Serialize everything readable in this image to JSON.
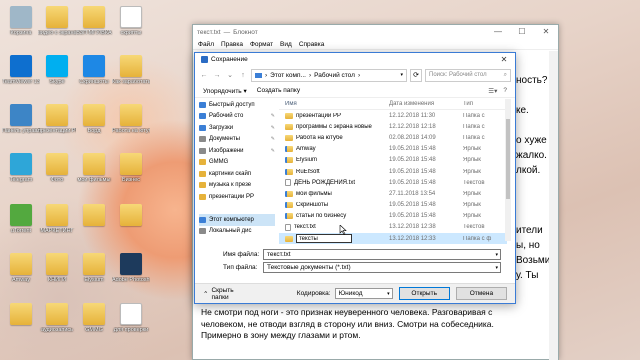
{
  "desktop": {
    "icons": [
      {
        "label": "Корзина",
        "kind": "trash",
        "color": "#9fb7c8"
      },
      {
        "label": "видео с экрана",
        "kind": "folder",
        "color": "#e6b23a"
      },
      {
        "label": "ВЗП МГУ/ВКА",
        "kind": "folder",
        "color": "#e6b23a"
      },
      {
        "label": "скрипты",
        "kind": "doc",
        "color": "#ffffff"
      },
      {
        "label": "TeamViewer 13",
        "kind": "app",
        "color": "#0e6fcf"
      },
      {
        "label": "Skype",
        "kind": "app",
        "color": "#00aff0"
      },
      {
        "label": "Скриншоты",
        "kind": "app",
        "color": "#1e88e5"
      },
      {
        "label": "Как заработать",
        "kind": "folder",
        "color": "#e6b23a"
      },
      {
        "label": "Панель управления",
        "kind": "app",
        "color": "#3d85c6"
      },
      {
        "label": "презентации PP",
        "kind": "folder",
        "color": "#e6b23a"
      },
      {
        "label": "Ворд",
        "kind": "folder",
        "color": "#e6b23a"
      },
      {
        "label": "Работа на ютубе",
        "kind": "folder",
        "color": "#e6b23a"
      },
      {
        "label": "Telegram",
        "kind": "app",
        "color": "#2ea6d8"
      },
      {
        "label": "Фото",
        "kind": "folder",
        "color": "#e6b23a"
      },
      {
        "label": "мои фильмы",
        "kind": "folder",
        "color": "#7a7a7a"
      },
      {
        "label": "Бизнес",
        "kind": "folder",
        "color": "#e6b23a"
      },
      {
        "label": "uTorrent",
        "kind": "app",
        "color": "#53a93f"
      },
      {
        "label": "МАРКЕТИНГ",
        "kind": "folder",
        "color": "#e6b23a"
      },
      {
        "label": "",
        "kind": "folder",
        "color": "#e6b23a"
      },
      {
        "label": "",
        "kind": "folder",
        "color": "#e6b23a"
      },
      {
        "label": "Amway",
        "kind": "folder",
        "color": "#e6b23a"
      },
      {
        "label": "КНИГИ",
        "kind": "folder",
        "color": "#e6b23a"
      },
      {
        "label": "Elysium",
        "kind": "folder",
        "color": "#e6b23a"
      },
      {
        "label": "Adobe Photosh...",
        "kind": "app",
        "color": "#1d3a5c"
      },
      {
        "label": "",
        "kind": "folder",
        "color": "#e6b23a"
      },
      {
        "label": "аудиозапись",
        "kind": "folder",
        "color": "#e6b23a"
      },
      {
        "label": "GMMG",
        "kind": "folder",
        "color": "#e6b23a"
      },
      {
        "label": "для проверки",
        "kind": "doc",
        "color": "#ffffff"
      }
    ]
  },
  "notepad": {
    "file": "текст.txt",
    "app": "Блокнот",
    "menu": [
      "Файл",
      "Правка",
      "Формат",
      "Вид",
      "Справка"
    ],
    "controls": {
      "minimize": "—",
      "maximize": "☐",
      "close": "✕"
    },
    "right_fragments": [
      "ность?",
      "",
      "ке.",
      "",
      "о хуже",
      "жалко.",
      "лкой.",
      "",
      "",
      "",
      "ители",
      "ы, но",
      "Возьми",
      "у. Ты"
    ],
    "bottom_text": [
      "Не смотри под ноги - это признак неуверенного человека. Разговаривая с",
      "человеком, не отводи взгляд в сторону или вниз. Смотри на собеседника.",
      "Примерно в зону между глазами и ртом."
    ]
  },
  "dialog": {
    "title": "Сохранение",
    "close": "✕",
    "breadcrumb": [
      "Этот комп...",
      "Рабочий стол"
    ],
    "search_placeholder": "Поиск: Рабочий стол",
    "toolbar": {
      "organize": "Упорядочить ▾",
      "new_folder": "Создать папку"
    },
    "sidebar": [
      {
        "label": "Быстрый доступ",
        "color": "#3b7fd6",
        "pinned": false,
        "selected": false
      },
      {
        "label": "Рабочий сто",
        "color": "#3b7fd6",
        "pinned": true,
        "selected": false
      },
      {
        "label": "Загрузки",
        "color": "#3b7fd6",
        "pinned": true,
        "selected": false
      },
      {
        "label": "Документы",
        "color": "#8a8a8a",
        "pinned": true,
        "selected": false
      },
      {
        "label": "Изображени",
        "color": "#8a8a8a",
        "pinned": true,
        "selected": false
      },
      {
        "label": "GMMG",
        "color": "#e6b23a",
        "pinned": false,
        "selected": false
      },
      {
        "label": "картинки скайп",
        "color": "#e6b23a",
        "pinned": false,
        "selected": false
      },
      {
        "label": "музыка к презе",
        "color": "#e6b23a",
        "pinned": false,
        "selected": false
      },
      {
        "label": "презентации PP",
        "color": "#e6b23a",
        "pinned": false,
        "selected": false
      },
      {
        "label": "",
        "color": "#ffffff",
        "pinned": false,
        "selected": false
      },
      {
        "label": "Этот компьютер",
        "color": "#3b7fd6",
        "pinned": false,
        "selected": true
      },
      {
        "label": "Локальный дис",
        "color": "#8a8a8a",
        "pinned": false,
        "selected": false
      }
    ],
    "columns": {
      "name": "Имя",
      "date": "Дата изменения",
      "type": "Тип"
    },
    "files": [
      {
        "name": "презентации PP",
        "date": "12.12.2018 11:30",
        "type": "Папка с",
        "icon": "folder"
      },
      {
        "name": "программы с экрана новые",
        "date": "12.12.2018 12:18",
        "type": "Папка с",
        "icon": "folder"
      },
      {
        "name": "Работа на ютубе",
        "date": "02.08.2018 14:09",
        "type": "Папка с",
        "icon": "folder"
      },
      {
        "name": "Amway",
        "date": "19.05.2018 15:48",
        "type": "Ярлык",
        "icon": "link"
      },
      {
        "name": "Elysium",
        "date": "19.05.2018 15:48",
        "type": "Ярлык",
        "icon": "link"
      },
      {
        "name": "RuElSoft",
        "date": "19.05.2018 15:48",
        "type": "Ярлык",
        "icon": "link"
      },
      {
        "name": "ДЕНЬ РОЖДЕНИЯ.txt",
        "date": "19.05.2018 15:48",
        "type": "Текстов",
        "icon": "txt"
      },
      {
        "name": "мои фильмы",
        "date": "27.11.2018 13:54",
        "type": "Ярлык",
        "icon": "link"
      },
      {
        "name": "Скриншоты",
        "date": "19.05.2018 15:48",
        "type": "Ярлык",
        "icon": "link"
      },
      {
        "name": "статьи по бизнесу",
        "date": "19.05.2018 15:48",
        "type": "Ярлык",
        "icon": "link"
      },
      {
        "name": "текст.txt",
        "date": "13.12.2018 12:38",
        "type": "Текстов",
        "icon": "txt"
      }
    ],
    "new_folder_row": {
      "value": "тексты",
      "date": "13.12.2018 12:33",
      "type": "Папка с ф"
    },
    "filename_label": "Имя файла:",
    "filename_value": "текст.txt",
    "filetype_label": "Тип файла:",
    "filetype_value": "Текстовые документы (*.txt)",
    "hide_folders": "Скрыть папки",
    "encoding_label": "Кодировка:",
    "encoding_value": "Юникод",
    "open_button": "Открыть",
    "cancel_button": "Отмена"
  }
}
